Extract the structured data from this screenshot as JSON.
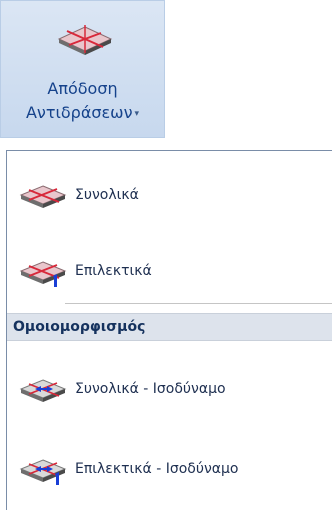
{
  "ribbon": {
    "button": {
      "label_line1": "Απόδοση",
      "label_line2": "Αντιδράσεων",
      "icon": "support-reactions-icon",
      "dropdown_caret": "▾"
    }
  },
  "menu": {
    "items": [
      {
        "label": "Συνολικά",
        "icon": "slab-reactions-icon"
      },
      {
        "label": "Επιλεκτικά",
        "icon": "slab-reactions-selective-icon"
      }
    ],
    "section_header": "Ομοιομορφισμός",
    "uniform_items": [
      {
        "label": "Συνολικά - Ισοδύναμο",
        "icon": "slab-equivalent-icon"
      },
      {
        "label": "Επιλεκτικά - Ισοδύναμο",
        "icon": "slab-equivalent-selective-icon"
      }
    ]
  },
  "colors": {
    "ribbon_bg": "#c7d8ee",
    "ribbon_text": "#15428b",
    "menu_text": "#1e2f50",
    "section_header_bg": "#dde3ec",
    "icon_line_red": "#d8283a",
    "icon_arrow_blue": "#1a3fd6"
  }
}
